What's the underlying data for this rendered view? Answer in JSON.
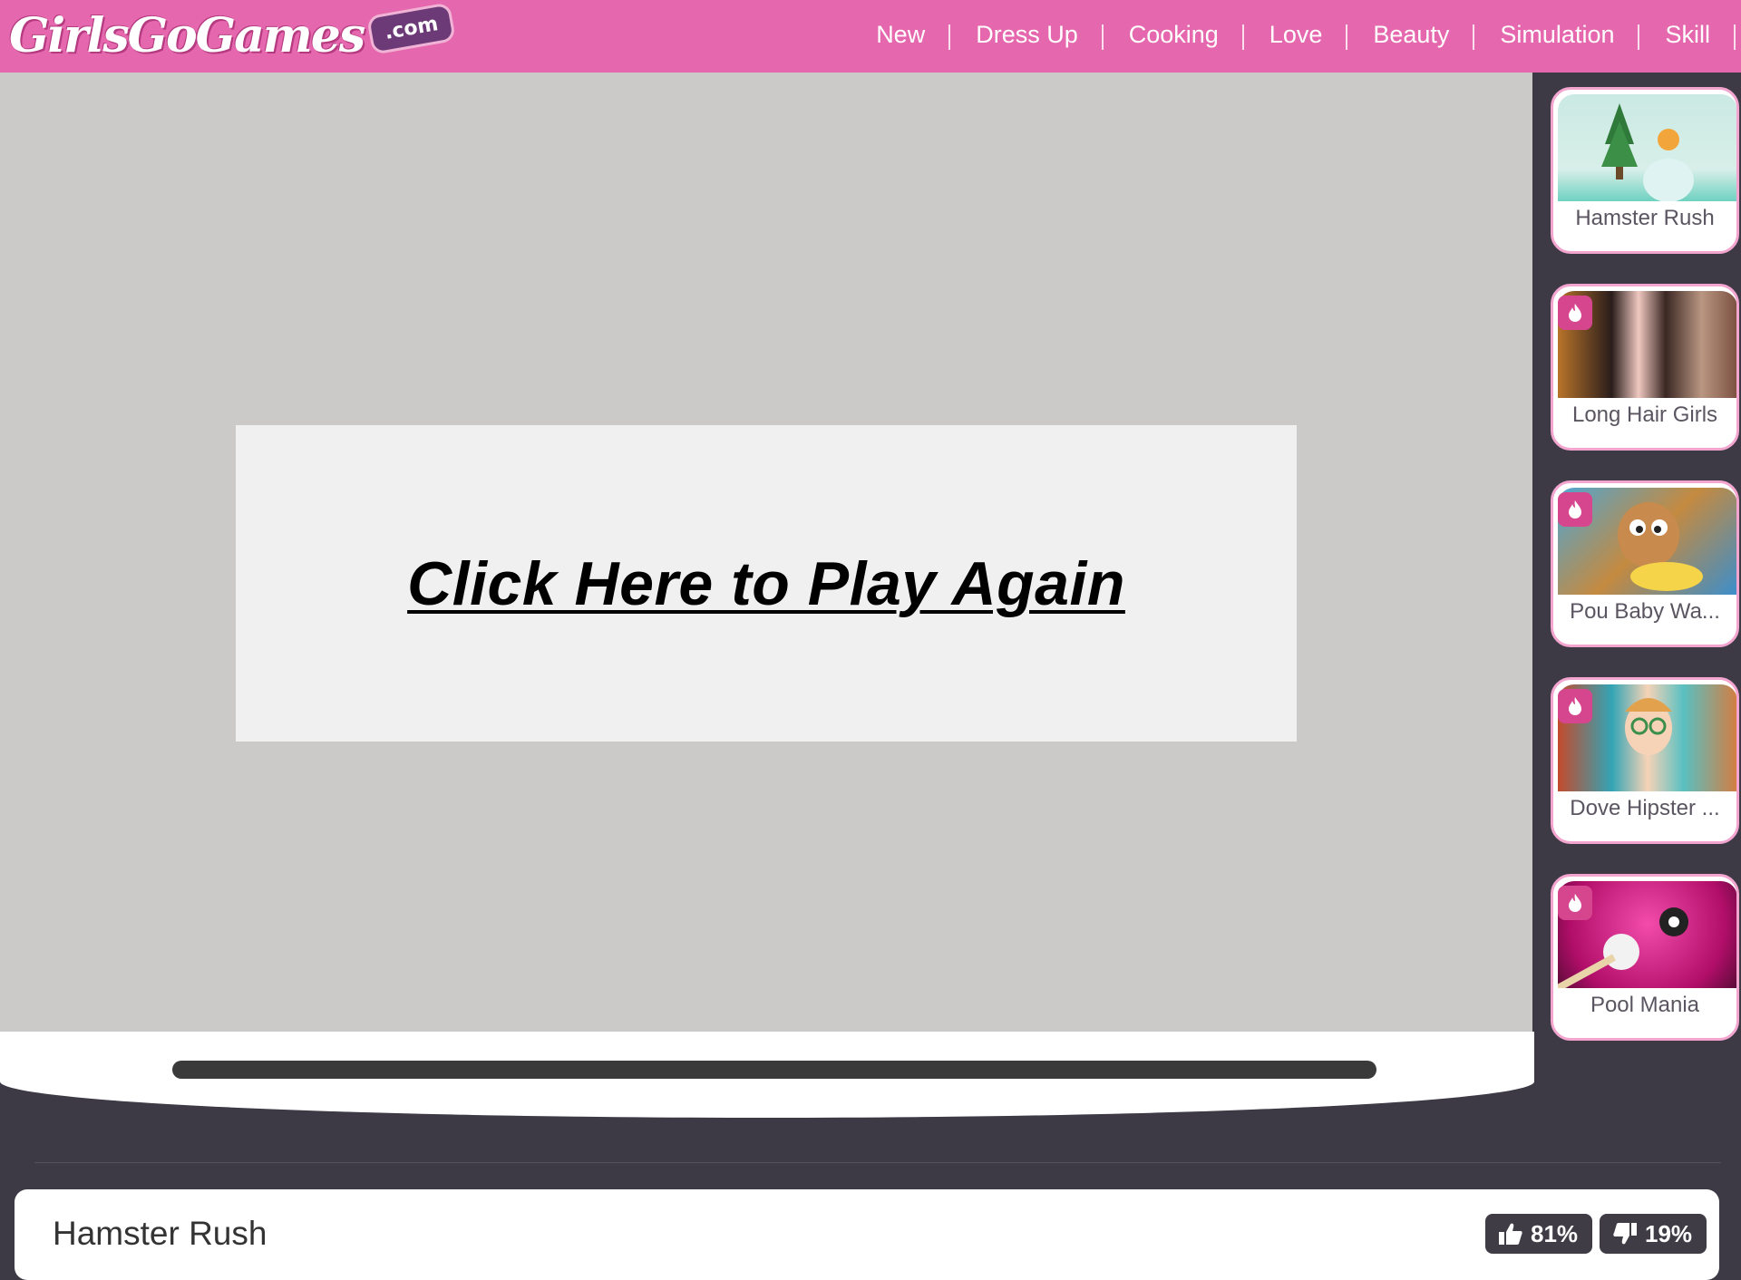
{
  "header": {
    "logo_text": "GirlsGoGames",
    "logo_suffix": ".com",
    "nav": [
      "New",
      "Dress Up",
      "Cooking",
      "Love",
      "Beauty",
      "Simulation",
      "Skill"
    ]
  },
  "game": {
    "play_again_label": "Click Here to Play Again"
  },
  "sidebar": {
    "games": [
      {
        "label": "Hamster Rush",
        "hot": false
      },
      {
        "label": "Long Hair Girls",
        "hot": true
      },
      {
        "label": "Pou Baby Wa...",
        "hot": true
      },
      {
        "label": "Dove Hipster ...",
        "hot": true
      },
      {
        "label": "Pool Mania",
        "hot": true
      }
    ]
  },
  "info": {
    "title": "Hamster Rush",
    "likes": "81%",
    "dislikes": "19%"
  },
  "colors": {
    "brand_pink": "#e567ad",
    "dark_bg": "#3d3a46",
    "card_border": "#f3a4cf",
    "hot_badge": "#d6468f"
  }
}
